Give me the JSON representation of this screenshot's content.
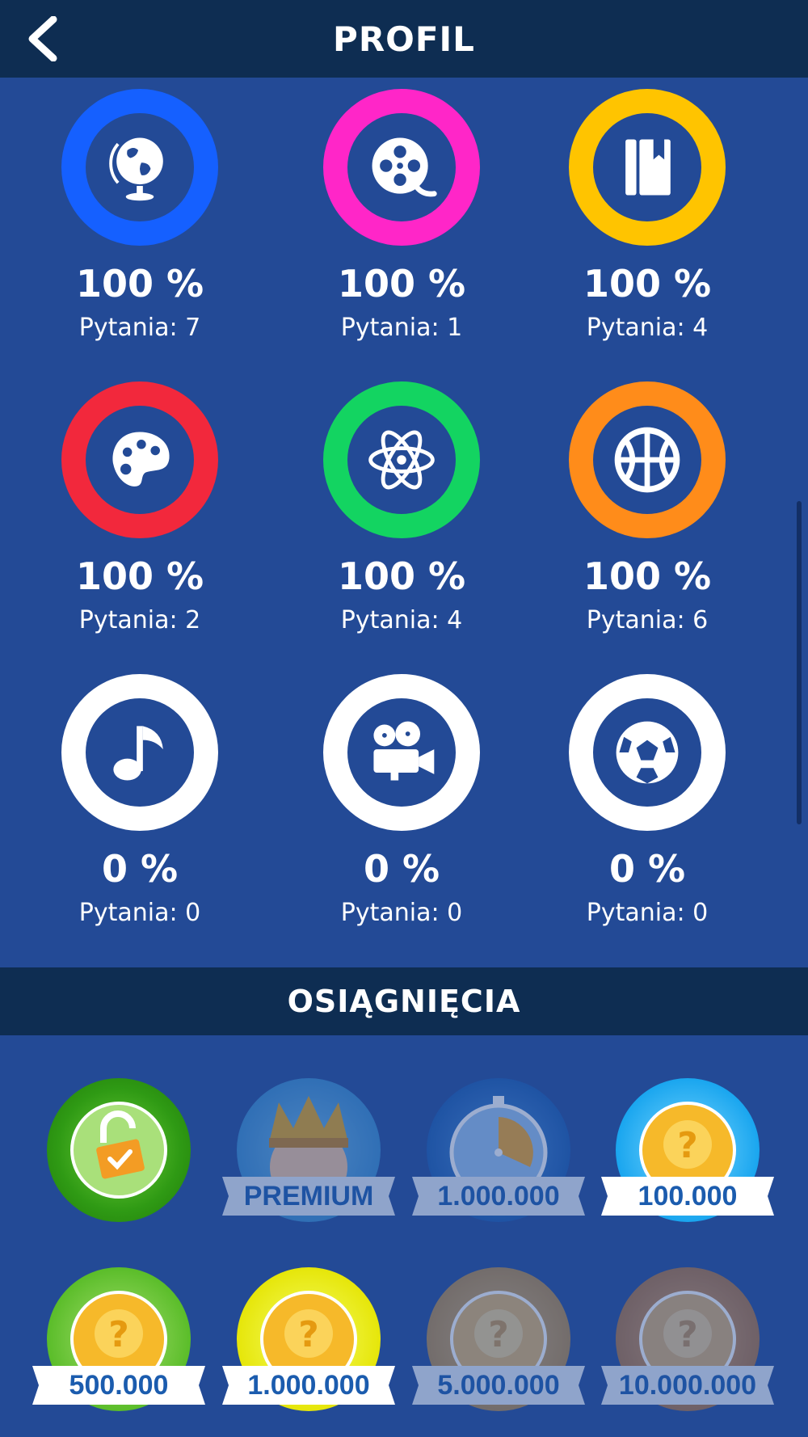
{
  "header": {
    "title": "PROFIL",
    "back_icon": "chevron-left-icon"
  },
  "categories": [
    {
      "icon": "globe-icon",
      "color": "#1560ff",
      "percent": "100 %",
      "questions": "Pytania: 7"
    },
    {
      "icon": "film-reel-icon",
      "color": "#ff26c8",
      "percent": "100 %",
      "questions": "Pytania: 1"
    },
    {
      "icon": "book-icon",
      "color": "#ffc400",
      "percent": "100 %",
      "questions": "Pytania: 4"
    },
    {
      "icon": "palette-icon",
      "color": "#f2283c",
      "percent": "100 %",
      "questions": "Pytania: 2"
    },
    {
      "icon": "atom-icon",
      "color": "#13d461",
      "percent": "100 %",
      "questions": "Pytania: 4"
    },
    {
      "icon": "basketball-icon",
      "color": "#ff8c1a",
      "percent": "100 %",
      "questions": "Pytania: 6"
    },
    {
      "icon": "music-note-icon",
      "color": "#ffffff",
      "percent": "0 %",
      "questions": "Pytania: 0"
    },
    {
      "icon": "movie-camera-icon",
      "color": "#ffffff",
      "percent": "0 %",
      "questions": "Pytania: 0"
    },
    {
      "icon": "soccer-ball-icon",
      "color": "#ffffff",
      "percent": "0 %",
      "questions": "Pytania: 0"
    }
  ],
  "achievements_title": "OSIĄGNIĘCIA",
  "achievements": [
    {
      "icon": "unlock-icon",
      "label": "",
      "unlocked": true
    },
    {
      "icon": "crown-icon",
      "label": "PREMIUM",
      "unlocked": false
    },
    {
      "icon": "stopwatch-icon",
      "label": "1.000.000",
      "unlocked": false
    },
    {
      "icon": "coins-icon",
      "label": "100.000",
      "unlocked": true
    },
    {
      "icon": "coins-icon",
      "label": "500.000",
      "unlocked": true
    },
    {
      "icon": "coins-icon",
      "label": "1.000.000",
      "unlocked": true
    },
    {
      "icon": "coins-icon",
      "label": "5.000.000",
      "unlocked": false
    },
    {
      "icon": "coins-icon",
      "label": "10.000.000",
      "unlocked": false
    }
  ]
}
